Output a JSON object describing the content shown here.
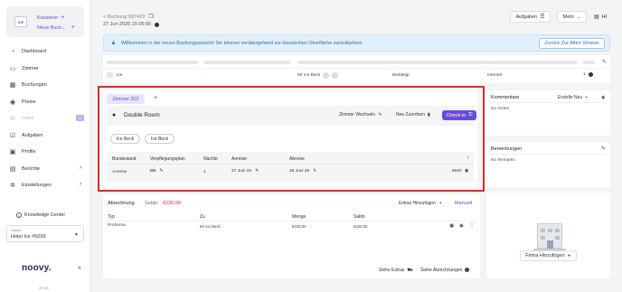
{
  "sidebar": {
    "profile": {
      "cashier_label": "Kassierer",
      "new_booking_label": "Neue Buch..."
    },
    "items": [
      {
        "label": "Dashboard",
        "icon": "dashboard-icon",
        "glyph": "◔"
      },
      {
        "label": "Zimmer",
        "icon": "bed-icon",
        "glyph": "▭"
      },
      {
        "label": "Buchungen",
        "icon": "calendar-icon",
        "glyph": "▦"
      },
      {
        "label": "Preise",
        "icon": "price-icon",
        "glyph": "◉"
      },
      {
        "label": "Inbox",
        "icon": "inbox-icon",
        "glyph": "✉",
        "badge": "0"
      },
      {
        "label": "Aufgaben",
        "icon": "tasks-icon",
        "glyph": "☑"
      },
      {
        "label": "Profile",
        "icon": "profile-icon",
        "glyph": "▣"
      },
      {
        "label": "Berichte",
        "icon": "reports-icon",
        "glyph": "▤"
      },
      {
        "label": "Einstellungen",
        "icon": "settings-icon",
        "glyph": "✲"
      }
    ],
    "knowledge_center": "Knowledge Center",
    "hotels_label": "Hotels",
    "hotel_selected": "Hotel Ice #5039",
    "logo": "noovy.",
    "version": "vn.ss"
  },
  "header": {
    "back_label": "< Buchung 997429",
    "datetime": "27 Jun 2025 15:05:56",
    "tasks_button": "Aufgaben",
    "more_button": "Mehr",
    "user_initials": "HI"
  },
  "banner": {
    "text": "Willkommen in der neuen Buchungsansicht! Sie können vorübergehend zur klassischen Oberfläche zurückkehren.",
    "button": "Zurück Zur Alten Version"
  },
  "summary": {
    "company": "Ice",
    "guest": "Mr Ice Beck",
    "status": "Bestätigt",
    "channel": "Internet",
    "count": "1"
  },
  "room": {
    "tab": "Zimmer 202",
    "add_tab": "+",
    "type": "Double Room",
    "change_room": "Zimmer Wechseln",
    "reassign": "Neu Zuordnen",
    "checkin": "Check-in",
    "guests": [
      "Ice Beck",
      "Ice Beck"
    ],
    "columns": [
      "Bundesland",
      "Verpflegungsplan",
      "Nächte",
      "Anreise",
      "Abreise"
    ],
    "row": {
      "state": "Anreise",
      "board": "BB",
      "nights": "1",
      "arrival": "27 Juni 25",
      "departure": "28 Juni 25",
      "more": "Mehr"
    }
  },
  "billing": {
    "title": "Abrechnung",
    "balance_label": "Saldo:",
    "balance_value": "€220.00",
    "add_extras": "Extras Hinzufügen",
    "manual": "Manuell",
    "columns": [
      "Typ",
      "Zu",
      "Menge",
      "Saldo"
    ],
    "row": {
      "type": "Proforma",
      "to": "Mr Ice Beck",
      "amount": "€220.00",
      "balance": "€220.00"
    },
    "see_extras": "Siehe Extras",
    "see_billings": "Siehe Abrechnungen"
  },
  "comments": {
    "title": "Kommentare",
    "create_new": "Erstelle Neu",
    "empty": "No Notes"
  },
  "remarks": {
    "title": "Bemerkungen",
    "empty": "No Remarks"
  },
  "company": {
    "add_button": "Firma Hinzufügen"
  },
  "colors": {
    "accent": "#6a4bd8",
    "highlight": "#d32f2f",
    "banner_bg": "#e1f0fb",
    "balance": "#d0195c"
  }
}
